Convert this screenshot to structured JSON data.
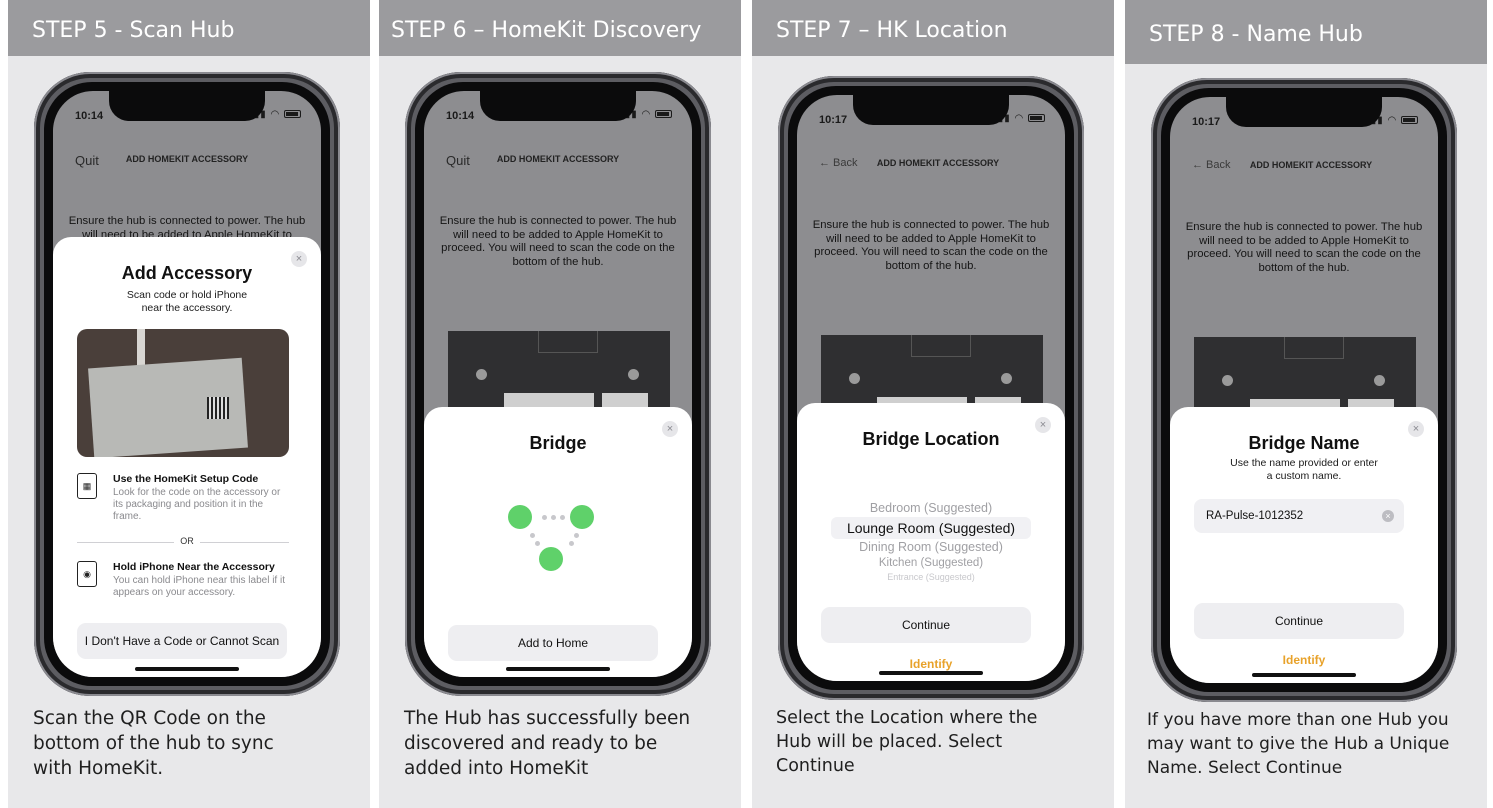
{
  "panels": [
    {
      "header": "STEP 5 - Scan Hub",
      "caption": "Scan the QR Code on the bottom of the hub to sync with HomeKit.",
      "phone": {
        "time": "10:14",
        "nav_left": "Quit",
        "nav_title": "ADD HOMEKIT ACCESSORY",
        "instructions": "Ensure the hub is connected to power. The hub will need to be added to Apple HomeKit to proceed. You will need to scan the code on the bottom of the hub.",
        "sheet": {
          "title": "Add Accessory",
          "subtitle": "Scan code or hold iPhone near the accessory.",
          "option1_title": "Use the HomeKit Setup Code",
          "option1_desc": "Look for the code on the accessory or its packaging and position it in the frame.",
          "or_label": "OR",
          "option2_title": "Hold iPhone Near the Accessory",
          "option2_desc": "You can hold iPhone near this label if it appears on your accessory.",
          "button": "I Don't Have a Code or Cannot Scan",
          "close": "×"
        }
      }
    },
    {
      "header": "STEP 6 – HomeKit Discovery",
      "caption": "The Hub has successfully been discovered and ready to be added into HomeKit",
      "phone": {
        "time": "10:14",
        "nav_left": "Quit",
        "nav_title": "ADD HOMEKIT ACCESSORY",
        "instructions": "Ensure the hub is connected to power. The hub will need to be added to Apple HomeKit to proceed. You will need to scan the code on the bottom of the hub.",
        "sheet": {
          "title": "Bridge",
          "button": "Add to Home",
          "close": "×"
        }
      }
    },
    {
      "header": "STEP 7 – HK Location",
      "caption": "Select the Location where the Hub will be placed. Select Continue",
      "phone": {
        "time": "10:17",
        "nav_left": "← Back",
        "nav_title": "ADD HOMEKIT ACCESSORY",
        "instructions": "Ensure the hub is connected to power. The hub will need to be added to Apple HomeKit to proceed. You will need to scan the code on the bottom of the hub.",
        "sheet": {
          "title": "Bridge Location",
          "options": [
            "Bedroom (Suggested)",
            "Lounge Room (Suggested)",
            "Dining Room (Suggested)",
            "Kitchen (Suggested)",
            "Entrance (Suggested)"
          ],
          "selected_index": 1,
          "button": "Continue",
          "link": "Identify",
          "close": "×"
        }
      }
    },
    {
      "header": "STEP 8 - Name Hub",
      "caption": "If you have more than one Hub you may want to give the Hub a Unique Name. Select Continue",
      "phone": {
        "time": "10:17",
        "nav_left": "← Back",
        "nav_title": "ADD HOMEKIT ACCESSORY",
        "instructions": "Ensure the hub is connected to power. The hub will need to be added to Apple HomeKit to proceed. You will need to scan the code on the bottom of the hub.",
        "sheet": {
          "title": "Bridge Name",
          "subtitle": "Use the name provided or enter a custom name.",
          "input_value": "RA-Pulse-1012352",
          "button": "Continue",
          "link": "Identify",
          "close": "×"
        }
      }
    }
  ],
  "colors": {
    "header_bg": "#9b9b9e",
    "panel_bg": "#e8e8ea",
    "accent_green": "#5fd16a",
    "accent_orange": "#e8a22a"
  }
}
